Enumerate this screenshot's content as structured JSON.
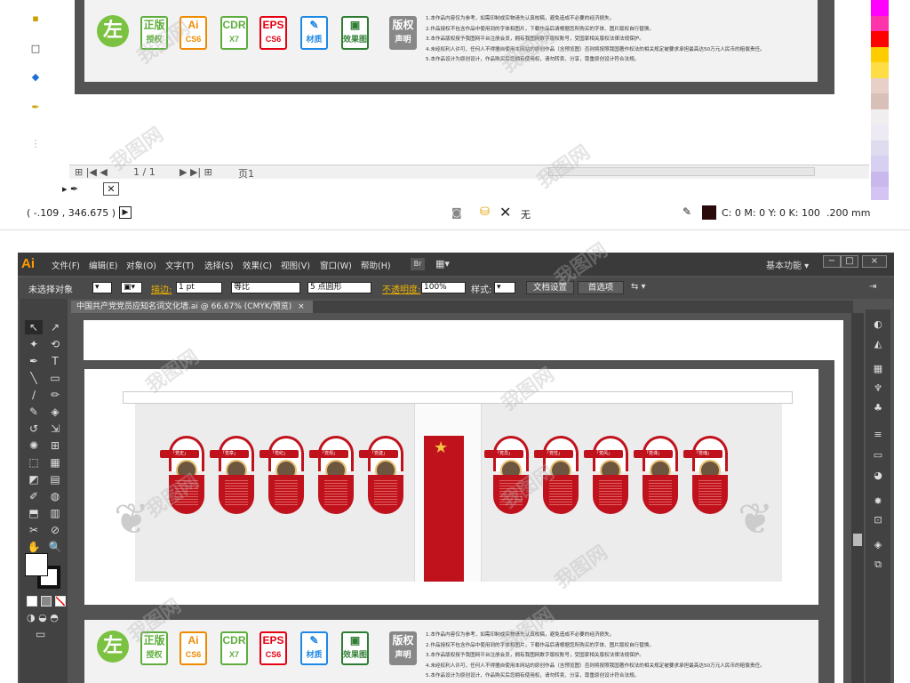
{
  "top": {
    "nav": {
      "page": "1 / 1",
      "page_tab": "页1"
    },
    "statusbar": {
      "coords": "( -.109 , 346.675 )",
      "fill_none": "无",
      "color": "C: 0 M: 0 Y: 0 K: 100",
      "stroke_weight": ".200 mm"
    },
    "swatches": [
      "#ff00ff",
      "#ff33aa",
      "#ff0000",
      "#ffcc00",
      "#ffdd44",
      "#e8d0c8",
      "#d8c0b8",
      "#f0eeee",
      "#eeeaf4",
      "#e0dcf0",
      "#d8d0f0",
      "#c8b8ec",
      "#d4c4f4"
    ]
  },
  "menubar": {
    "logo": "Ai",
    "items": [
      "文件(F)",
      "编辑(E)",
      "对象(O)",
      "文字(T)",
      "选择(S)",
      "效果(C)",
      "视图(V)",
      "窗口(W)",
      "帮助(H)"
    ],
    "br": "Br",
    "workspace": "基本功能",
    "win_buttons": [
      "−",
      "□",
      "×"
    ]
  },
  "controlbar": {
    "no_selection": "未选择对象",
    "stroke_label": "描边:",
    "stroke_value": "1 pt",
    "line_style": "等比",
    "brush": "5 点圆形",
    "opacity_label": "不透明度:",
    "opacity_value": "100%",
    "style_label": "样式:",
    "doc_setup": "文档设置",
    "preferences": "首选项"
  },
  "tab": {
    "title": "中国共产党党员应知名词文化墙.ai @ 66.67% (CMYK/预览)",
    "close": "×"
  },
  "infobar": {
    "logo_char": "左",
    "badges": [
      {
        "top": "正版",
        "bottom": "授权",
        "color": "#5fae3d"
      },
      {
        "top": "Ai",
        "bottom": "CS6",
        "color": "#f08a00"
      },
      {
        "top": "CDR",
        "bottom": "X7",
        "color": "#5fae3d"
      },
      {
        "top": "EPS",
        "bottom": "CS6",
        "color": "#e60012"
      },
      {
        "top": "✎",
        "bottom": "材质",
        "color": "#1e88e5"
      },
      {
        "top": "▣",
        "bottom": "效果图",
        "color": "#2e7d32"
      },
      {
        "top": "版权",
        "bottom": "声明",
        "color": "#888888"
      }
    ],
    "notes": [
      "1.本作品内容仅为参考，如需印制成实物请先认真校稿，避免造成不必要的经济损失。",
      "2.作品授权不包含作品中使用到的字体和图片，下载作品后请根据您所购买的字体、图片版权自行替换。",
      "3.本作品版权授予我图网平台注册会员，拥有我图网数字版权账号，受国家相关版权法律法规保护。",
      "4.未经权利人许可，任何人不得擅自使用本网站的原创作品（含预览图）否则将按照我国著作权法的相关规定被要求承担最高达50万元人民币的赔偿责任。",
      "5.本作品设计为原创设计，作品购买后您拥有使用权，请勿转卖、分享，尊重原创设计符合法规。"
    ]
  },
  "wall": {
    "cards_left": [
      "「党史」",
      "「党章」",
      "「党纪」",
      "「党规」",
      "「党建」"
    ],
    "cards_right": [
      "「党员」",
      "「党性」",
      "「党风」",
      "「党课」",
      "「党魂」"
    ]
  },
  "watermark": "我图网"
}
